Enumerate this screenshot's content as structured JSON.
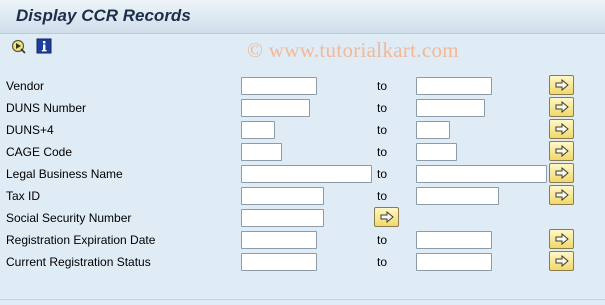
{
  "header": {
    "title": "Display CCR Records"
  },
  "toolbar": {
    "execute_icon": "execute-icon",
    "info_icon": "info-icon"
  },
  "watermark": "© www.tutorialkart.com",
  "to_label": "to",
  "fields": [
    {
      "label": "Vendor",
      "low_value": "",
      "high_value": ""
    },
    {
      "label": "DUNS Number",
      "low_value": "",
      "high_value": ""
    },
    {
      "label": "DUNS+4",
      "low_value": "",
      "high_value": ""
    },
    {
      "label": "CAGE Code",
      "low_value": "",
      "high_value": ""
    },
    {
      "label": "Legal Business Name",
      "low_value": "",
      "high_value": ""
    },
    {
      "label": "Tax ID",
      "low_value": "",
      "high_value": ""
    },
    {
      "label": "Social Security Number",
      "low_value": ""
    },
    {
      "label": "Registration Expiration Date",
      "low_value": "",
      "high_value": ""
    },
    {
      "label": "Current Registration Status",
      "low_value": "",
      "high_value": ""
    }
  ],
  "colors": {
    "background": "#dfebf5",
    "title": "#1c2f4a",
    "multi_select_button": "#f2d86a"
  }
}
